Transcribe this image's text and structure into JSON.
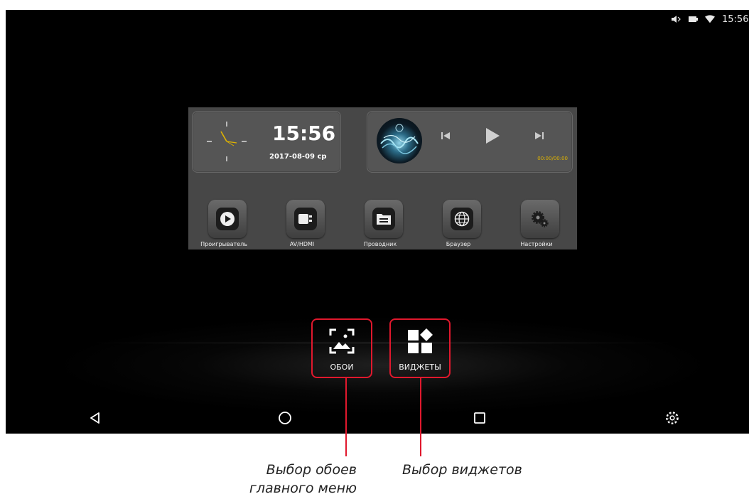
{
  "status_bar": {
    "time": "15:56",
    "icons": [
      "mute-icon",
      "battery-icon",
      "wifi-icon"
    ]
  },
  "clock_widget": {
    "time": "15:56",
    "date": "2017-08-09 ср"
  },
  "music_widget": {
    "progress": "00:00/00:00",
    "accent_color": "#e0b400",
    "controls": [
      "prev-icon",
      "play-icon",
      "next-icon"
    ]
  },
  "apps": [
    {
      "label": "Проигрыватель",
      "icon": "player-icon"
    },
    {
      "label": "AV/HDMI",
      "icon": "av-hdmi-icon"
    },
    {
      "label": "Проводник",
      "icon": "file-manager-icon"
    },
    {
      "label": "Браузер",
      "icon": "globe-icon"
    },
    {
      "label": "Настройки",
      "icon": "gears-icon"
    }
  ],
  "options": {
    "wallpaper_label": "ОБОИ",
    "widgets_label": "ВИДЖЕТЫ",
    "highlight_color": "#e0182d"
  },
  "navbar": {
    "icons": [
      "back-icon",
      "home-icon",
      "recent-apps-icon",
      "settings-icon"
    ]
  },
  "captions": {
    "wallpaper_line1": "Выбор обоев",
    "wallpaper_line2": "главного меню",
    "widgets": "Выбор виджетов"
  }
}
